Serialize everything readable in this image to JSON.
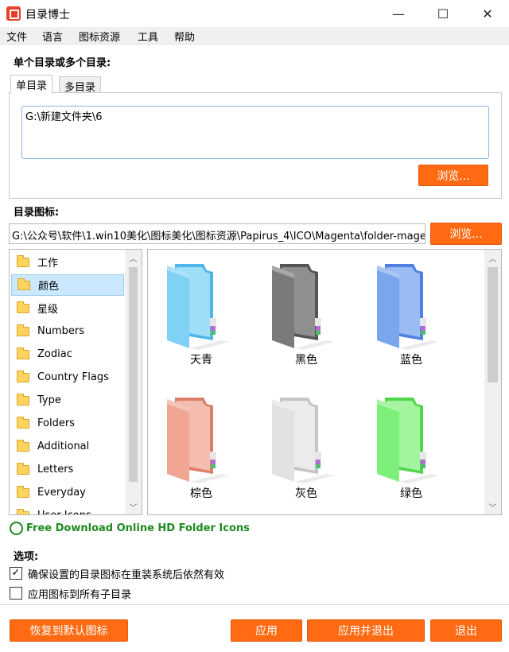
{
  "window": {
    "title": "目录博士",
    "minimize": "—",
    "maximize": "☐",
    "close": "✕"
  },
  "menu": [
    "文件",
    "语言",
    "图标资源",
    "工具",
    "帮助"
  ],
  "dirs_section": {
    "label": "单个目录或多个目录:",
    "tabs": [
      "单目录",
      "多目录"
    ],
    "active_tab": "单目录",
    "path_value": "G:\\新建文件夹\\6",
    "browse": "浏览..."
  },
  "icon_section": {
    "label": "目录图标:",
    "path_value": "G:\\公众号\\软件\\1.win10美化\\图标美化\\图标资源\\Papirus_4\\ICO\\Magenta\\folder-mage",
    "browse": "浏览..."
  },
  "categories": [
    "工作",
    "颜色",
    "星级",
    "Numbers",
    "Zodiac",
    "Country Flags",
    "Type",
    "Folders",
    "Additional",
    "Letters",
    "Everyday",
    "User Icons"
  ],
  "selected_category": "颜色",
  "icons": [
    {
      "label": "天青",
      "front": "#7fd1f5",
      "back": "#4fb6ea",
      "tab": "#a6e2fb"
    },
    {
      "label": "黑色",
      "front": "#7a7a7a",
      "back": "#555555",
      "tab": "#969696"
    },
    {
      "label": "蓝色",
      "front": "#7aa6ee",
      "back": "#4f7fe0",
      "tab": "#a3c2f6"
    },
    {
      "label": "棕色",
      "front": "#f0a693",
      "back": "#dc7f6a",
      "tab": "#f7c4b6"
    },
    {
      "label": "灰色",
      "front": "#e2e2e2",
      "back": "#c4c4c4",
      "tab": "#f0f0f0"
    },
    {
      "label": "绿色",
      "front": "#7ef07a",
      "back": "#4fd84a",
      "tab": "#adf7a9"
    }
  ],
  "link_text": "Free Download Online HD Folder Icons",
  "options": {
    "label": "选项:",
    "items": [
      {
        "label": "确保设置的目录图标在重装系统后依然有效",
        "checked": true
      },
      {
        "label": "应用图标到所有子目录",
        "checked": false
      }
    ]
  },
  "buttons": {
    "restore": "恢复到默认图标",
    "apply": "应用",
    "apply_exit": "应用并退出",
    "exit": "退出"
  },
  "colors": {
    "accent": "#ff6a13",
    "link": "#1e8a1e",
    "selection": "#cce8ff"
  }
}
